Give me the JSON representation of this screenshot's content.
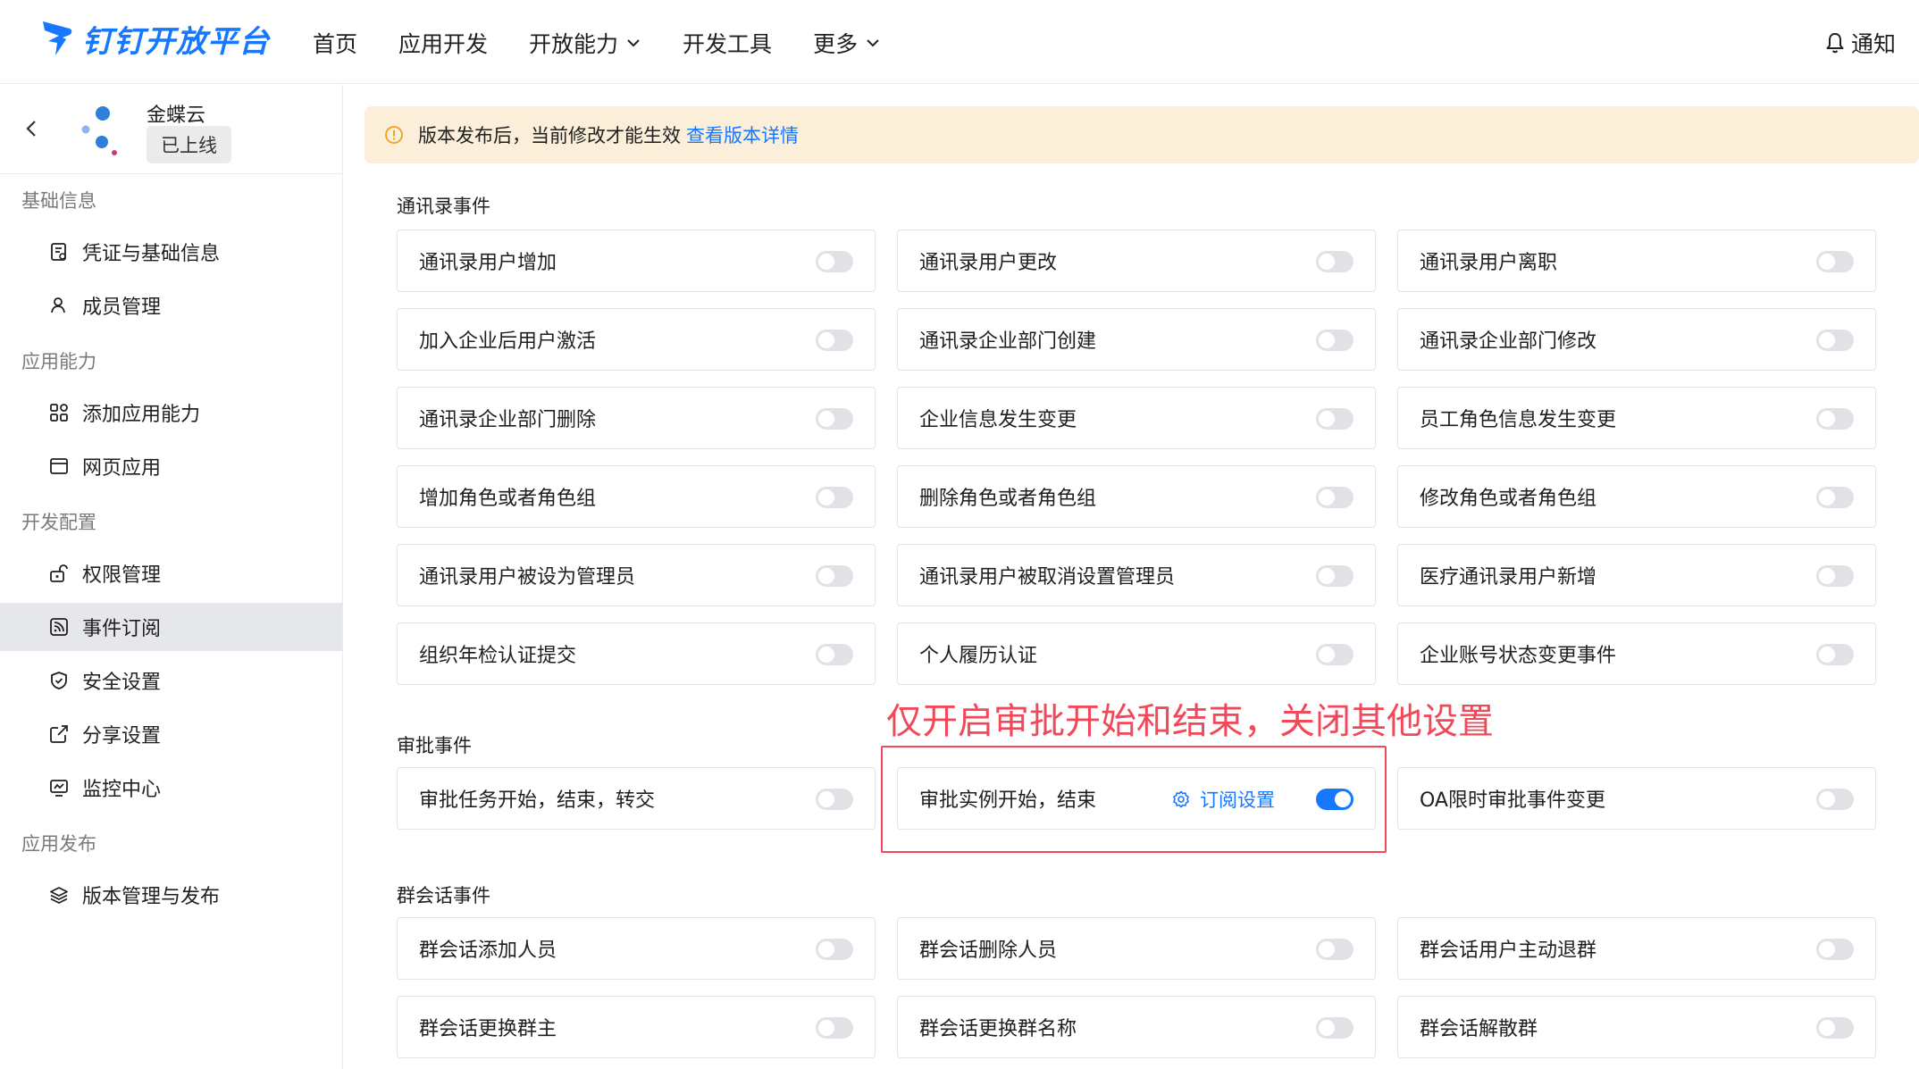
{
  "header": {
    "logo_text": "钉钉开放平台",
    "nav": [
      {
        "label": "首页",
        "dropdown": false
      },
      {
        "label": "应用开发",
        "dropdown": false
      },
      {
        "label": "开放能力",
        "dropdown": true
      },
      {
        "label": "开发工具",
        "dropdown": false
      },
      {
        "label": "更多",
        "dropdown": true
      }
    ],
    "notify_label": "通知"
  },
  "app": {
    "name": "金蝶云",
    "status": "已上线"
  },
  "sidebar": {
    "groups": [
      {
        "title": "基础信息",
        "items": [
          {
            "label": "凭证与基础信息",
            "icon": "credential-icon"
          },
          {
            "label": "成员管理",
            "icon": "user-icon"
          }
        ]
      },
      {
        "title": "应用能力",
        "items": [
          {
            "label": "添加应用能力",
            "icon": "apps-icon"
          },
          {
            "label": "网页应用",
            "icon": "webpage-icon"
          }
        ]
      },
      {
        "title": "开发配置",
        "items": [
          {
            "label": "权限管理",
            "icon": "permission-icon"
          },
          {
            "label": "事件订阅",
            "icon": "rss-icon",
            "active": true
          },
          {
            "label": "安全设置",
            "icon": "shield-icon"
          },
          {
            "label": "分享设置",
            "icon": "share-icon"
          },
          {
            "label": "监控中心",
            "icon": "monitor-icon"
          }
        ]
      },
      {
        "title": "应用发布",
        "items": [
          {
            "label": "版本管理与发布",
            "icon": "layers-icon"
          }
        ]
      }
    ]
  },
  "alert": {
    "text": "版本发布后，当前修改才能生效",
    "link": "查看版本详情",
    "background": "#fcefd9",
    "icon_color": "#f0a020"
  },
  "sections": {
    "contacts": {
      "title": "通讯录事件",
      "items": [
        {
          "label": "通讯录用户增加",
          "enabled": false
        },
        {
          "label": "通讯录用户更改",
          "enabled": false
        },
        {
          "label": "通讯录用户离职",
          "enabled": false
        },
        {
          "label": "加入企业后用户激活",
          "enabled": false
        },
        {
          "label": "通讯录企业部门创建",
          "enabled": false
        },
        {
          "label": "通讯录企业部门修改",
          "enabled": false
        },
        {
          "label": "通讯录企业部门删除",
          "enabled": false
        },
        {
          "label": "企业信息发生变更",
          "enabled": false
        },
        {
          "label": "员工角色信息发生变更",
          "enabled": false
        },
        {
          "label": "增加角色或者角色组",
          "enabled": false
        },
        {
          "label": "删除角色或者角色组",
          "enabled": false
        },
        {
          "label": "修改角色或者角色组",
          "enabled": false
        },
        {
          "label": "通讯录用户被设为管理员",
          "enabled": false
        },
        {
          "label": "通讯录用户被取消设置管理员",
          "enabled": false
        },
        {
          "label": "医疗通讯录用户新增",
          "enabled": false
        },
        {
          "label": "组织年检认证提交",
          "enabled": false
        },
        {
          "label": "个人履历认证",
          "enabled": false
        },
        {
          "label": "企业账号状态变更事件",
          "enabled": false
        }
      ]
    },
    "approval": {
      "title": "审批事件",
      "items": [
        {
          "label": "审批任务开始，结束，转交",
          "enabled": false
        },
        {
          "label": "审批实例开始，结束",
          "enabled": true,
          "settings_link": "订阅设置"
        },
        {
          "label": "OA限时审批事件变更",
          "enabled": false
        }
      ]
    },
    "group_chat": {
      "title": "群会话事件",
      "items": [
        {
          "label": "群会话添加人员",
          "enabled": false
        },
        {
          "label": "群会话删除人员",
          "enabled": false
        },
        {
          "label": "群会话用户主动退群",
          "enabled": false
        },
        {
          "label": "群会话更换群主",
          "enabled": false
        },
        {
          "label": "群会话更换群名称",
          "enabled": false
        },
        {
          "label": "群会话解散群",
          "enabled": false
        }
      ]
    }
  },
  "annotation": {
    "text": "仅开启审批开始和结束，关闭其他设置",
    "color": "#f1495a"
  },
  "colors": {
    "accent": "#1677ff",
    "toggle_off": "#e1e2e5",
    "active_menu_bg": "#e6e7ea"
  }
}
